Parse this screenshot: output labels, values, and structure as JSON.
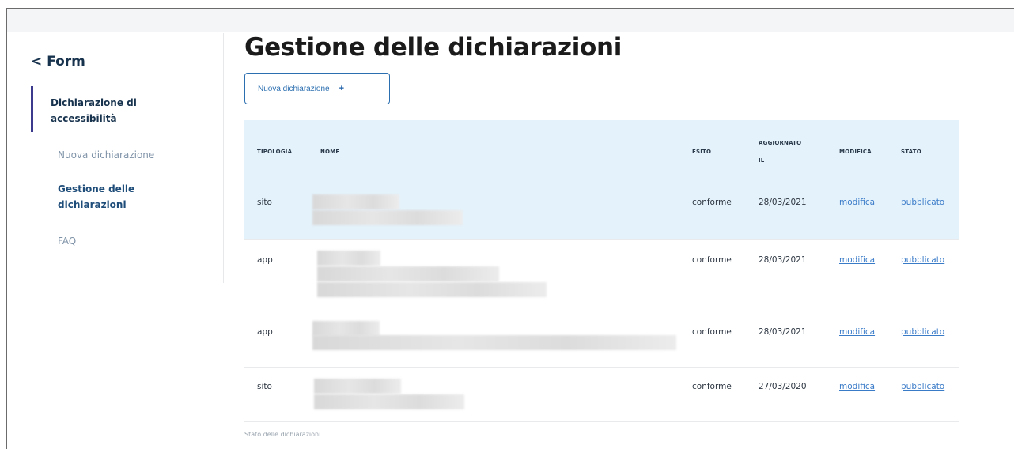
{
  "sidebar": {
    "back_label": "< Form",
    "section_label": "Dichiarazione di accessibilità",
    "items": [
      {
        "label": "Nuova dichiarazione"
      },
      {
        "label": "Gestione delle dichiarazioni"
      },
      {
        "label": "FAQ"
      }
    ]
  },
  "main": {
    "title": "Gestione delle dichiarazioni",
    "new_button_label": "Nuova dichiarazione",
    "new_button_icon": "+",
    "table": {
      "headers": {
        "tipologia": "TIPOLOGIA",
        "nome": "NOME",
        "esito": "ESITO",
        "aggiornato": "AGGIORNATO IL",
        "modifica": "MODIFICA",
        "stato": "STATO"
      },
      "rows": [
        {
          "tipologia": "sito",
          "esito": "conforme",
          "aggiornato": "28/03/2021",
          "modifica": "modifica",
          "stato": "pubblicato"
        },
        {
          "tipologia": "app",
          "esito": "conforme",
          "aggiornato": "28/03/2021",
          "modifica": "modifica",
          "stato": "pubblicato"
        },
        {
          "tipologia": "app",
          "esito": "conforme",
          "aggiornato": "28/03/2021",
          "modifica": "modifica",
          "stato": "pubblicato"
        },
        {
          "tipologia": "sito",
          "esito": "conforme",
          "aggiornato": "27/03/2020",
          "modifica": "modifica",
          "stato": "pubblicato"
        }
      ]
    },
    "caption": "Stato delle dichiarazioni"
  },
  "colors": {
    "accent": "#2c6fb0",
    "link": "#3a7bc8",
    "header_bg": "#e4f2fb",
    "sidebar_active_bar": "#3b3a8c"
  }
}
